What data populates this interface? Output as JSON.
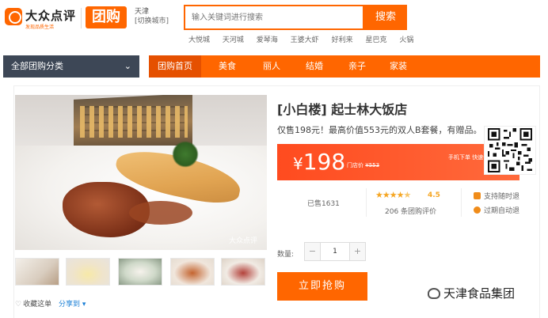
{
  "header": {
    "logo_name": "大众点评",
    "logo_slogan": "发现品质生活",
    "tuangou": "团购",
    "city": "天津",
    "city_switch": "[切换城市]",
    "search_placeholder": "输入关键词进行搜索",
    "search_button": "搜索",
    "hot_words": [
      "大悦城",
      "天河城",
      "爱琴海",
      "王婆大虾",
      "好利来",
      "星巴克",
      "火锅"
    ]
  },
  "nav": {
    "category_menu": "全部团购分类",
    "items": [
      "团购首页",
      "美食",
      "丽人",
      "结婚",
      "亲子",
      "家装"
    ],
    "active_index": 0
  },
  "deal": {
    "title": "[小白楼] 起士林大饭店",
    "description": "仅售198元！最高价值553元的双人B套餐，有赠品。",
    "photo_watermark": "大众点评",
    "price_symbol": "¥",
    "price": "198",
    "store_price_label": "门店价",
    "store_price": "¥553",
    "mobile_order": "手机下单 快速便捷",
    "sold": "已售1631",
    "rating": "4.5",
    "rating_stars": 4.5,
    "reviews": "206 条团购评价",
    "guarantees": [
      "支持随时退",
      "过期自动退"
    ],
    "collect": "收藏这单",
    "share": "分享到",
    "quantity_label": "数量:",
    "quantity_value": "1",
    "minus": "−",
    "plus": "+",
    "buy_button": "立即抢购"
  },
  "watermark": {
    "text": "天津食品集团"
  },
  "colors": {
    "accent": "#ff6600",
    "nav_dark": "#3d4756",
    "price_red": "#ff4b1f",
    "link_blue": "#1a7fd6",
    "star": "#f5a623"
  }
}
